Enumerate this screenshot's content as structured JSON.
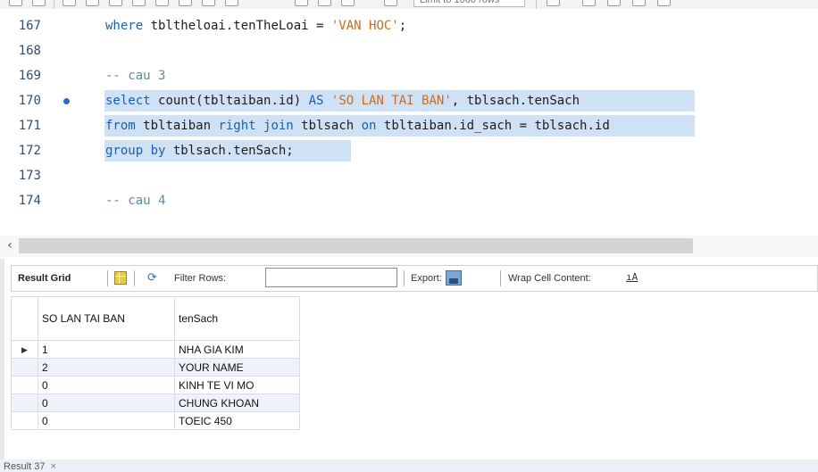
{
  "toolbar": {
    "limit_placeholder": "Limit to 1000 rows"
  },
  "editor": {
    "lines": [
      {
        "num": "167",
        "segments": [
          {
            "t": "where ",
            "c": "kw"
          },
          {
            "t": "tbltheloai.tenTheLoai = ",
            "c": "plain"
          },
          {
            "t": "'VAN HOC'",
            "c": "str"
          },
          {
            "t": ";",
            "c": "plain"
          }
        ]
      },
      {
        "num": "168",
        "segments": []
      },
      {
        "num": "169",
        "segments": [
          {
            "t": "-- cau 3",
            "c": "cmt"
          }
        ]
      },
      {
        "num": "170",
        "segments": [
          {
            "t": "select ",
            "c": "kw"
          },
          {
            "t": "count(tbltaiban.id) ",
            "c": "plain"
          },
          {
            "t": "AS ",
            "c": "kw"
          },
          {
            "t": "'SO LAN TAI BAN'",
            "c": "str"
          },
          {
            "t": ", tblsach.tenSach",
            "c": "plain"
          }
        ]
      },
      {
        "num": "171",
        "segments": [
          {
            "t": "from ",
            "c": "kw"
          },
          {
            "t": "tbltaiban ",
            "c": "plain"
          },
          {
            "t": "right join ",
            "c": "kw"
          },
          {
            "t": "tblsach ",
            "c": "plain"
          },
          {
            "t": "on ",
            "c": "kw"
          },
          {
            "t": "tbltaiban.id_sach = tblsach.id",
            "c": "plain"
          }
        ]
      },
      {
        "num": "172",
        "segments": [
          {
            "t": "group by ",
            "c": "kw"
          },
          {
            "t": "tblsach.tenSach;",
            "c": "plain"
          }
        ]
      },
      {
        "num": "173",
        "segments": []
      },
      {
        "num": "174",
        "segments": [
          {
            "t": "-- cau 4",
            "c": "cmt"
          }
        ]
      }
    ]
  },
  "result_toolbar": {
    "result_grid": "Result Grid",
    "filter_rows": "Filter Rows:",
    "export": "Export:",
    "wrap_cell": "Wrap Cell Content:",
    "wrap_icon": "ıA"
  },
  "result": {
    "columns": [
      "SO LAN TAI BAN",
      "tenSach"
    ],
    "rows": [
      [
        "1",
        "NHA GIA KIM"
      ],
      [
        "2",
        "YOUR NAME"
      ],
      [
        "0",
        "KINH TE VI MO"
      ],
      [
        "0",
        "CHUNG KHOAN"
      ],
      [
        "0",
        "TOEIC 450"
      ]
    ]
  },
  "bottom_tab": {
    "label": "Result 37",
    "close": "×"
  },
  "colors": {
    "selection": "#cfe2f5",
    "keyword": "#1a5fb4",
    "string": "#d2691e",
    "comment": "#5f8c9c"
  }
}
